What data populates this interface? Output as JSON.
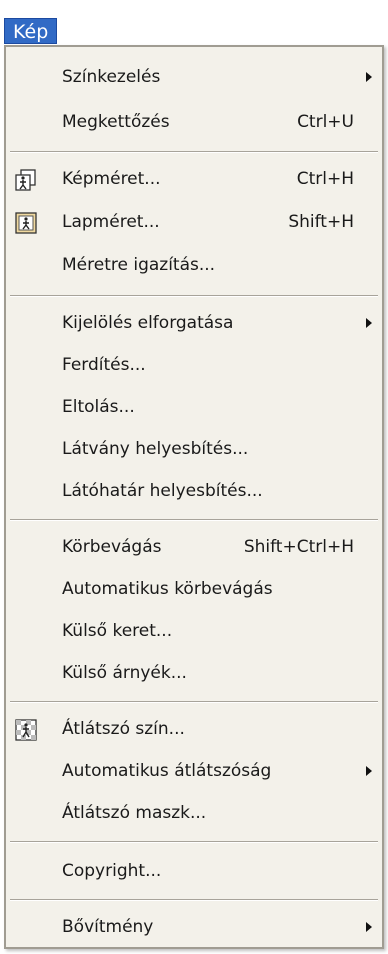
{
  "menubar": {
    "title": "Kép"
  },
  "menu": {
    "items": [
      {
        "label": "Színkezelés",
        "shortcut": "",
        "submenu": true
      },
      {
        "label": "Megkettőzés",
        "shortcut": "Ctrl+U",
        "submenu": false
      },
      {
        "label": "Képméret...",
        "shortcut": "Ctrl+H",
        "submenu": false,
        "icon": "image-size-icon"
      },
      {
        "label": "Lapméret...",
        "shortcut": "Shift+H",
        "submenu": false,
        "icon": "page-size-icon"
      },
      {
        "label": "Méretre igazítás...",
        "shortcut": "",
        "submenu": false
      },
      {
        "label": "Kijelölés elforgatása",
        "shortcut": "",
        "submenu": true
      },
      {
        "label": "Ferdítés...",
        "shortcut": "",
        "submenu": false
      },
      {
        "label": "Eltolás...",
        "shortcut": "",
        "submenu": false
      },
      {
        "label": "Látvány helyesbítés...",
        "shortcut": "",
        "submenu": false
      },
      {
        "label": "Látóhatár helyesbítés...",
        "shortcut": "",
        "submenu": false
      },
      {
        "label": "Körbevágás",
        "shortcut": "Shift+Ctrl+H",
        "submenu": false
      },
      {
        "label": "Automatikus körbevágás",
        "shortcut": "",
        "submenu": false
      },
      {
        "label": "Külső keret...",
        "shortcut": "",
        "submenu": false
      },
      {
        "label": "Külső árnyék...",
        "shortcut": "",
        "submenu": false
      },
      {
        "label": "Átlátszó szín...",
        "shortcut": "",
        "submenu": false,
        "icon": "transparent-color-icon"
      },
      {
        "label": "Automatikus átlátszóság",
        "shortcut": "",
        "submenu": true
      },
      {
        "label": "Átlátszó maszk...",
        "shortcut": "",
        "submenu": false
      },
      {
        "label": "Copyright...",
        "shortcut": "",
        "submenu": false
      },
      {
        "label": "Bővítmény",
        "shortcut": "",
        "submenu": true
      }
    ]
  },
  "colors": {
    "menu_background": "#f3f1ea",
    "highlight": "#316ac5",
    "separator": "#a7a39a"
  }
}
